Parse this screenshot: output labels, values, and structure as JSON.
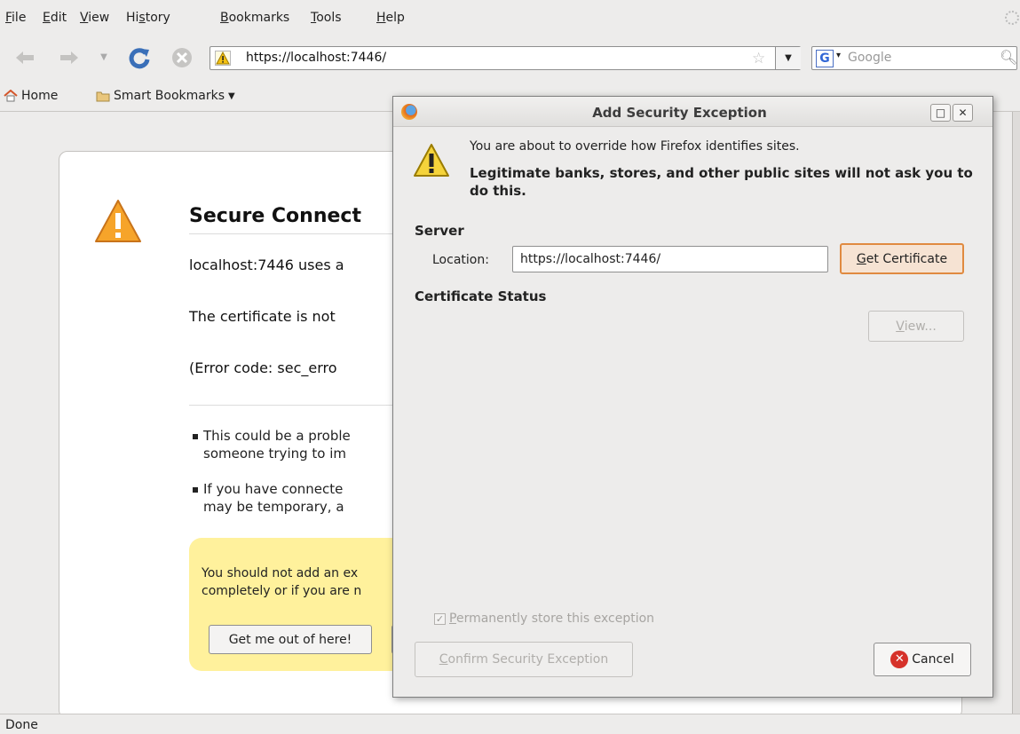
{
  "menubar": {
    "items": [
      "File",
      "Edit",
      "View",
      "History",
      "Bookmarks",
      "Tools",
      "Help"
    ]
  },
  "navbar": {
    "url": "https://localhost:7446/",
    "search_placeholder": "Google",
    "search_engine_letter": "G",
    "icons": [
      "back-icon",
      "forward-icon",
      "history-dropdown-icon",
      "reload-icon",
      "stop-icon",
      "warning-icon",
      "star-icon",
      "search-icon"
    ]
  },
  "bookmarks": {
    "home": "Home",
    "smart": "Smart Bookmarks"
  },
  "page": {
    "title": "Secure Connect",
    "line1": "localhost:7446 uses a",
    "line2": "The certificate is not",
    "line3": "(Error code: sec_erro",
    "bullet1_a": "This could be a proble",
    "bullet1_b": "someone trying to im",
    "bullet2_a": "If you have connecte",
    "bullet2_b": "may be temporary, a",
    "yellow_a": "You should not add an ex",
    "yellow_b": "completely or if you are n",
    "getout_label": "Get me out of here!"
  },
  "status": {
    "text": "Done"
  },
  "dialog": {
    "title": "Add Security Exception",
    "text1": "You are about to override how Firefox identifies sites.",
    "text2": "Legitimate banks, stores, and other public sites will not ask you to do this.",
    "server_heading": "Server",
    "location_label": "Location:",
    "location_value": "https://localhost:7446/",
    "get_certificate_label": "Get Certificate",
    "cert_status_heading": "Certificate Status",
    "view_label": "View...",
    "permanent_label": "Permanently store this exception",
    "confirm_label": "Confirm Security Exception",
    "cancel_label": "Cancel"
  },
  "colors": {
    "warning_orange": "#f5a623",
    "yellow_box": "#fff19c",
    "cancel_red": "#d6322a",
    "focus_orange": "#e08a40"
  }
}
